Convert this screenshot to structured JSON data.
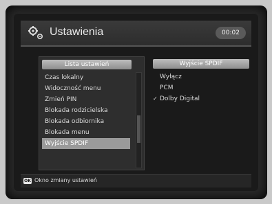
{
  "header": {
    "icon": "gears-icon",
    "title": "Ustawienia",
    "clock": "00:02"
  },
  "settings_list": {
    "header": "Lista ustawień",
    "items": [
      {
        "label": "Czas lokalny"
      },
      {
        "label": "Widoczność menu"
      },
      {
        "label": "Zmień PIN"
      },
      {
        "label": "Blokada rodzicielska"
      },
      {
        "label": "Blokada odbiornika"
      },
      {
        "label": "Blokada menu"
      },
      {
        "label": "Wyjście SPDIF",
        "selected": true
      }
    ]
  },
  "spdif_panel": {
    "header": "Wyjście SPDIF",
    "options": [
      {
        "label": "Wyłącz"
      },
      {
        "label": "PCM"
      },
      {
        "label": "Dolby Digital",
        "checked": true
      }
    ]
  },
  "footer": {
    "key_icon": "ok-key-icon",
    "key_label": "OK",
    "hint": "Okno zmiany ustawień"
  }
}
